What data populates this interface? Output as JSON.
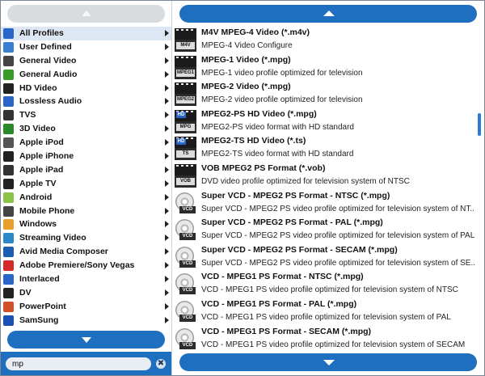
{
  "categories": [
    {
      "label": "All Profiles",
      "icon": "play-icon",
      "color": "#2a66c9"
    },
    {
      "label": "User Defined",
      "icon": "user-icon",
      "color": "#3a7fd0"
    },
    {
      "label": "General Video",
      "icon": "film-icon",
      "color": "#444444"
    },
    {
      "label": "General Audio",
      "icon": "music-note-icon",
      "color": "#3a9a2a"
    },
    {
      "label": "HD Video",
      "icon": "hd-icon",
      "color": "#222222"
    },
    {
      "label": "Lossless Audio",
      "icon": "music-icon",
      "color": "#2a66c9"
    },
    {
      "label": "TVS",
      "icon": "tv-icon",
      "color": "#333333"
    },
    {
      "label": "3D Video",
      "icon": "3d-icon",
      "color": "#2a8a2a"
    },
    {
      "label": "Apple iPod",
      "icon": "ipod-icon",
      "color": "#555555"
    },
    {
      "label": "Apple iPhone",
      "icon": "iphone-icon",
      "color": "#222222"
    },
    {
      "label": "Apple iPad",
      "icon": "ipad-icon",
      "color": "#333333"
    },
    {
      "label": "Apple TV",
      "icon": "apple-tv-icon",
      "color": "#222222"
    },
    {
      "label": "Android",
      "icon": "android-icon",
      "color": "#8bc34a"
    },
    {
      "label": "Mobile Phone",
      "icon": "phone-icon",
      "color": "#444444"
    },
    {
      "label": "Windows",
      "icon": "windows-icon",
      "color": "#e8a02a"
    },
    {
      "label": "Streaming Video",
      "icon": "globe-icon",
      "color": "#2a88c9"
    },
    {
      "label": "Avid Media Composer",
      "icon": "avid-icon",
      "color": "#1a5fb4"
    },
    {
      "label": "Adobe Premiere/Sony Vegas",
      "icon": "adobe-icon",
      "color": "#d42a2a"
    },
    {
      "label": "Interlaced",
      "icon": "interlaced-icon",
      "color": "#2a66c9"
    },
    {
      "label": "DV",
      "icon": "dv-icon",
      "color": "#222222"
    },
    {
      "label": "PowerPoint",
      "icon": "powerpoint-icon",
      "color": "#d0502a"
    },
    {
      "label": "SamSung",
      "icon": "samsung-icon",
      "color": "#1a4fb4"
    }
  ],
  "search": {
    "value": "mp",
    "clear": "✖"
  },
  "formats": [
    {
      "title": "M4V MPEG-4 Video (*.m4v)",
      "desc": "MPEG-4 Video Configure",
      "icon": "film",
      "tag": "M4V"
    },
    {
      "title": "MPEG-1 Video (*.mpg)",
      "desc": "MPEG-1 video profile optimized for television",
      "icon": "film",
      "tag": "MPEG1"
    },
    {
      "title": "MPEG-2 Video (*.mpg)",
      "desc": "MPEG-2 video profile optimized for television",
      "icon": "film",
      "tag": "MPEG2"
    },
    {
      "title": "MPEG2-PS HD Video (*.mpg)",
      "desc": "MPEG2-PS video format with HD standard",
      "icon": "hd",
      "tag": "MPG"
    },
    {
      "title": "MPEG2-TS HD Video (*.ts)",
      "desc": "MPEG2-TS video format with HD standard",
      "icon": "hd",
      "tag": "TS"
    },
    {
      "title": "VOB MPEG2 PS Format (*.vob)",
      "desc": "DVD video profile optimized for television system of NTSC",
      "icon": "film",
      "tag": "VOB"
    },
    {
      "title": "Super VCD - MPEG2 PS Format - NTSC (*.mpg)",
      "desc": "Super VCD - MPEG2 PS video profile optimized for television system of NT...",
      "icon": "vcd",
      "tag": "VCD"
    },
    {
      "title": "Super VCD - MPEG2 PS Format - PAL (*.mpg)",
      "desc": "Super VCD - MPEG2 PS video profile optimized for television system of PAL",
      "icon": "vcd",
      "tag": "VCD"
    },
    {
      "title": "Super VCD - MPEG2 PS Format - SECAM (*.mpg)",
      "desc": "Super VCD - MPEG2 PS video profile optimized for television system of SE...",
      "icon": "vcd",
      "tag": "VCD"
    },
    {
      "title": "VCD - MPEG1 PS Format - NTSC (*.mpg)",
      "desc": "VCD - MPEG1 PS video profile optimized for television system of NTSC",
      "icon": "vcd",
      "tag": "VCD"
    },
    {
      "title": "VCD - MPEG1 PS Format - PAL (*.mpg)",
      "desc": "VCD - MPEG1 PS video profile optimized for television system of PAL",
      "icon": "vcd",
      "tag": "VCD"
    },
    {
      "title": "VCD - MPEG1 PS Format - SECAM (*.mpg)",
      "desc": "VCD - MPEG1 PS video profile optimized for television system of SECAM",
      "icon": "vcd",
      "tag": "VCD"
    }
  ],
  "colors": {
    "accent": "#1f6fc0",
    "disabled": "#d9dcdf",
    "selected_row": "#dde7f4"
  }
}
